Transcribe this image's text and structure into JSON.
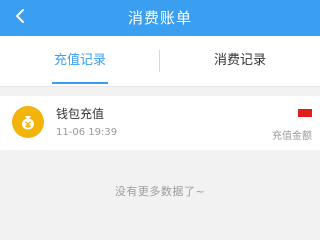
{
  "header": {
    "title": "消费账单",
    "back_icon": "chevron-left-icon",
    "background": "#3a9ff0"
  },
  "tabs": [
    {
      "label": "充值记录",
      "active": true
    },
    {
      "label": "消费记录",
      "active": false
    }
  ],
  "records": [
    {
      "icon": "wallet-money-bag-icon",
      "title": "钱包充值",
      "time": "11-06 19:39",
      "amount_label": "充值金额",
      "amount_color": "#e01e1e"
    }
  ],
  "footer": {
    "note": "没有更多数据了~"
  }
}
